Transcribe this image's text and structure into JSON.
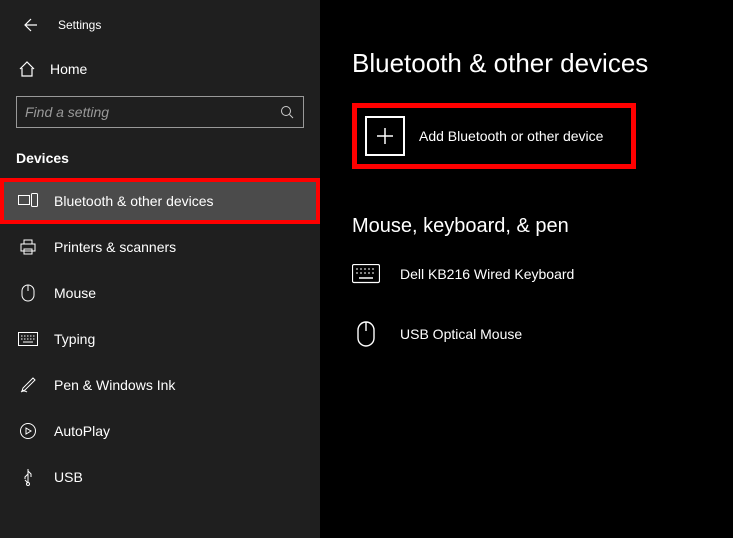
{
  "titlebar": {
    "app_title": "Settings"
  },
  "sidebar": {
    "home_label": "Home",
    "search_placeholder": "Find a setting",
    "group_header": "Devices",
    "items": [
      {
        "label": "Bluetooth & other devices"
      },
      {
        "label": "Printers & scanners"
      },
      {
        "label": "Mouse"
      },
      {
        "label": "Typing"
      },
      {
        "label": "Pen & Windows Ink"
      },
      {
        "label": "AutoPlay"
      },
      {
        "label": "USB"
      }
    ]
  },
  "main": {
    "page_title": "Bluetooth & other devices",
    "add_device_label": "Add Bluetooth or other device",
    "section_header": "Mouse, keyboard, & pen",
    "devices": [
      {
        "label": "Dell KB216 Wired Keyboard"
      },
      {
        "label": "USB Optical Mouse"
      }
    ]
  }
}
